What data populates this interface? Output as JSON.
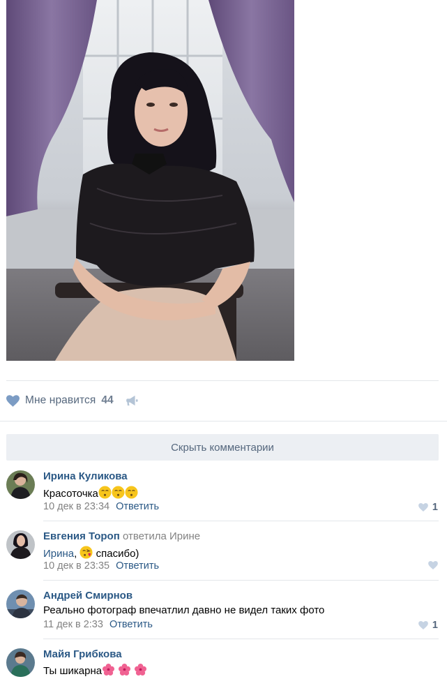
{
  "post": {
    "likes_label": "Мне нравится",
    "likes_count": "44"
  },
  "comments_toggle": "Скрыть комментарии",
  "comments": [
    {
      "author": "Ирина Куликова",
      "reply_to": "",
      "mention": "",
      "text": "Красоточка",
      "emoji_after": [
        "kissing-face-icon",
        "kissing-face-icon",
        "kissing-face-icon"
      ],
      "time": "10 дек в 23:34",
      "reply_label": "Ответить",
      "likes": "1"
    },
    {
      "author": "Евгения Тороп",
      "reply_to": "ответила Ирине",
      "mention": "Ирина",
      "text": "спасибо)",
      "emoji_after": [
        "face-blowing-kiss-icon"
      ],
      "time": "10 дек в 23:35",
      "reply_label": "Ответить",
      "likes": ""
    },
    {
      "author": "Андрей Смирнов",
      "reply_to": "",
      "mention": "",
      "text": "Реально фотограф впечатлил давно не видел таких фото",
      "emoji_after": [],
      "time": "11 дек в 2:33",
      "reply_label": "Ответить",
      "likes": "1"
    },
    {
      "author": "Майя Грибкова",
      "reply_to": "",
      "mention": "",
      "text": "Ты шикарна",
      "emoji_after": [
        "hibiscus-icon",
        "hibiscus-icon",
        "hibiscus-icon"
      ],
      "time": "",
      "reply_label": "",
      "likes": ""
    }
  ],
  "colors": {
    "link": "#2a5885",
    "muted": "#828282",
    "like_blue": "#7c9cc4",
    "button_bg": "#eceff3"
  }
}
